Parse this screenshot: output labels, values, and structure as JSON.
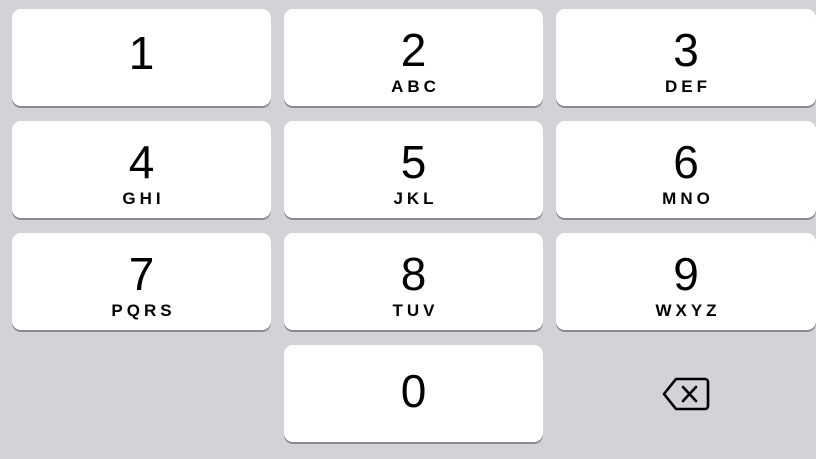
{
  "keypad": {
    "keys": [
      {
        "digit": "1",
        "letters": ""
      },
      {
        "digit": "2",
        "letters": "ABC"
      },
      {
        "digit": "3",
        "letters": "DEF"
      },
      {
        "digit": "4",
        "letters": "GHI"
      },
      {
        "digit": "5",
        "letters": "JKL"
      },
      {
        "digit": "6",
        "letters": "MNO"
      },
      {
        "digit": "7",
        "letters": "PQRS"
      },
      {
        "digit": "8",
        "letters": "TUV"
      },
      {
        "digit": "9",
        "letters": "WXYZ"
      },
      {
        "digit": "0",
        "letters": ""
      }
    ],
    "delete_icon": "backspace-icon"
  },
  "colors": {
    "background": "#d1d3d9",
    "key": "#ffffff",
    "key_shadow": "#898a8e",
    "text": "#000000"
  }
}
